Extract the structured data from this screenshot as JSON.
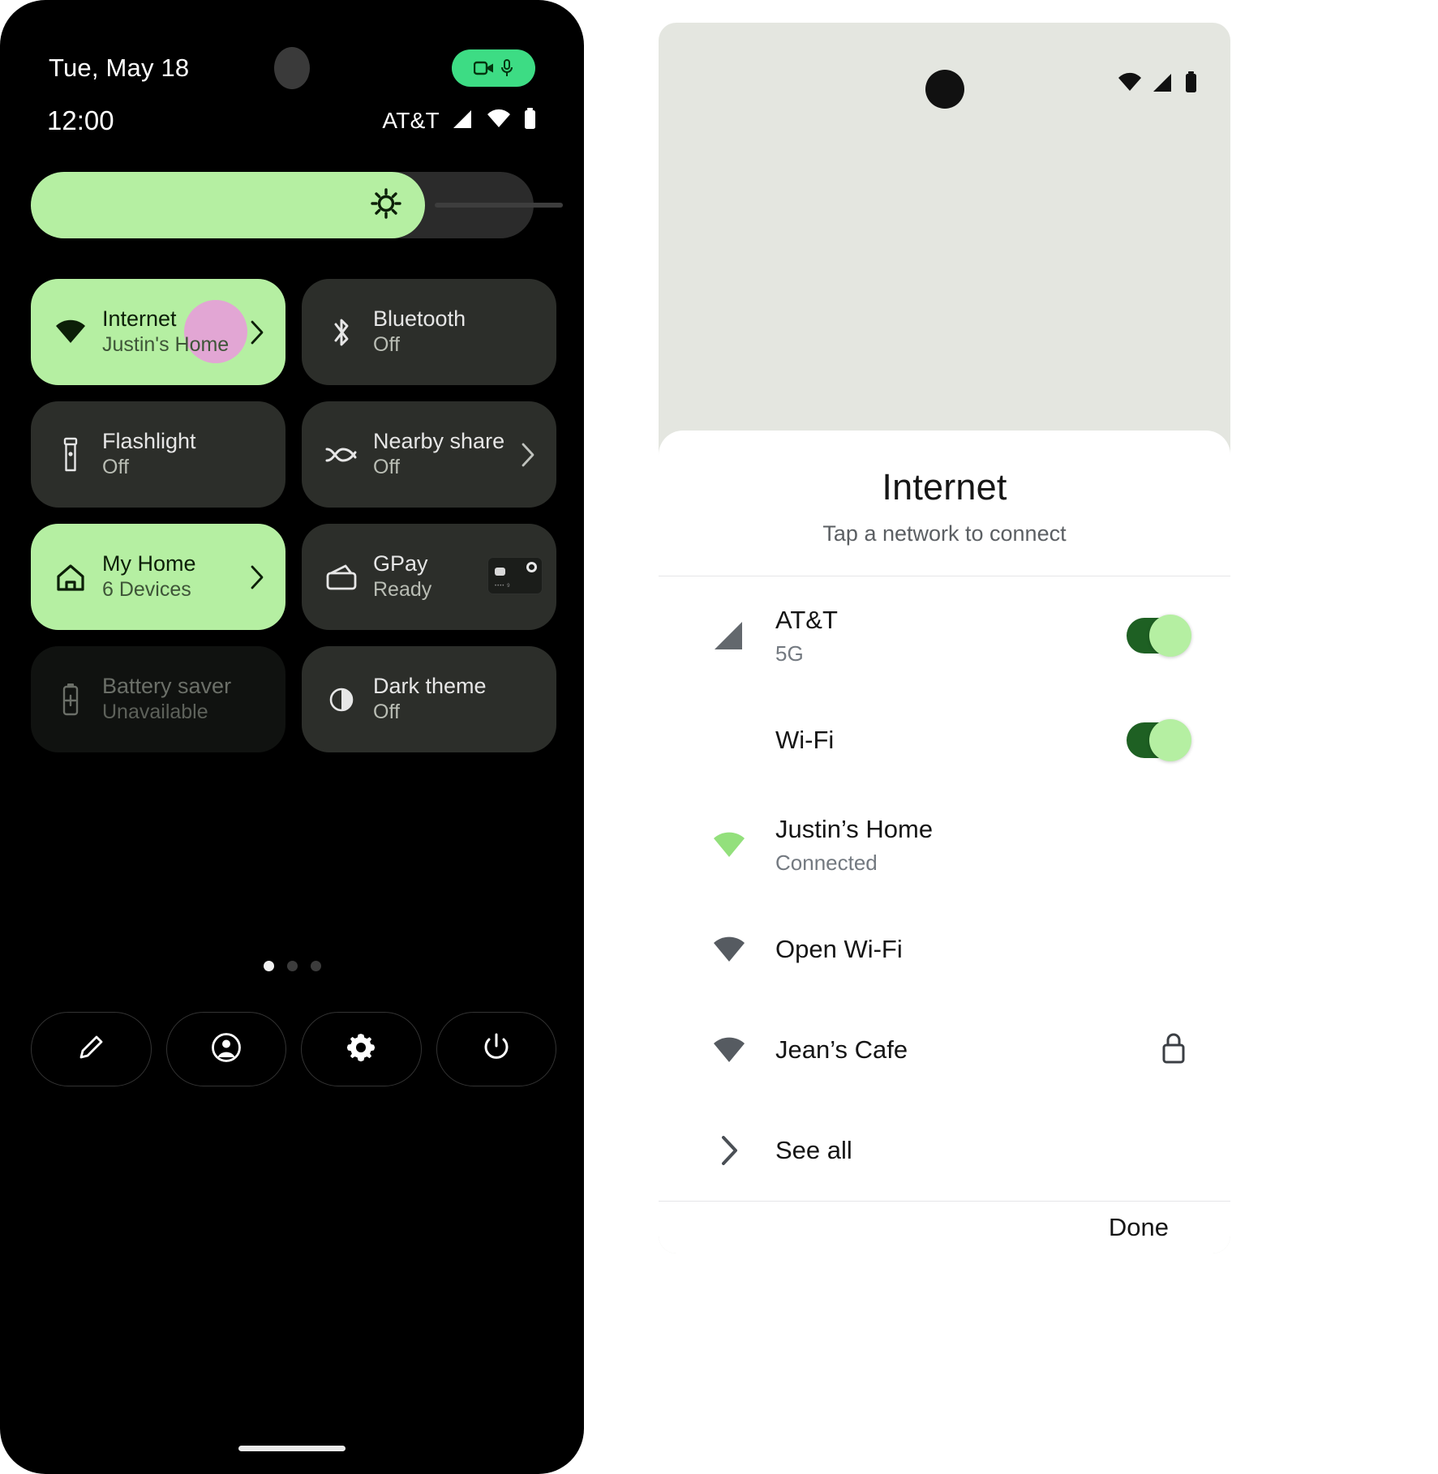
{
  "quick_settings": {
    "status_bar": {
      "date": "Tue, May 18",
      "clock": "12:00",
      "carrier": "AT&T",
      "privacy_chip": {
        "camera_icon": "video-camera-icon",
        "mic_icon": "microphone-icon"
      },
      "icons": [
        "cellular-signal-icon",
        "wifi-icon",
        "battery-icon"
      ]
    },
    "brightness": {
      "name": "brightness-slider",
      "icon": "brightness-icon",
      "fill_percent": 75
    },
    "tiles": [
      {
        "title": "Internet",
        "subtitle": "Justin's Home",
        "icon": "wifi-icon",
        "state": "active",
        "has_chevron": true,
        "touch_indicator": true
      },
      {
        "title": "Bluetooth",
        "subtitle": "Off",
        "icon": "bluetooth-icon",
        "state": "inactive",
        "has_chevron": false,
        "touch_indicator": false
      },
      {
        "title": "Flashlight",
        "subtitle": "Off",
        "icon": "flashlight-icon",
        "state": "inactive",
        "has_chevron": false,
        "touch_indicator": false
      },
      {
        "title": "Nearby share",
        "subtitle": "Off",
        "icon": "nearby-share-icon",
        "state": "inactive",
        "has_chevron": true,
        "touch_indicator": false
      },
      {
        "title": "My Home",
        "subtitle": "6 Devices",
        "icon": "home-icon",
        "state": "active",
        "has_chevron": true,
        "touch_indicator": false
      },
      {
        "title": "GPay",
        "subtitle": "Ready",
        "icon": "wallet-icon",
        "state": "inactive",
        "has_chevron": false,
        "touch_indicator": false,
        "card_thumbnail": {
          "name": "payment-card-thumbnail",
          "masked_number": "•••• 9"
        }
      },
      {
        "title": "Battery saver",
        "subtitle": "Unavailable",
        "icon": "battery-saver-icon",
        "state": "disabled",
        "has_chevron": false,
        "touch_indicator": false
      },
      {
        "title": "Dark theme",
        "subtitle": "Off",
        "icon": "dark-theme-icon",
        "state": "inactive",
        "has_chevron": false,
        "touch_indicator": false
      }
    ],
    "pagination": {
      "total": 3,
      "current": 1
    },
    "footer_buttons": [
      {
        "name": "edit-tiles-button",
        "icon": "pencil-icon"
      },
      {
        "name": "user-switcher-button",
        "icon": "account-circle-icon"
      },
      {
        "name": "settings-button",
        "icon": "gear-icon"
      },
      {
        "name": "power-button",
        "icon": "power-icon"
      }
    ]
  },
  "internet_dialog": {
    "status_bar": {
      "icons": [
        "wifi-icon",
        "cellular-signal-icon",
        "battery-icon"
      ]
    },
    "title": "Internet",
    "subtitle": "Tap a network to connect",
    "rows": [
      {
        "title": "AT&T",
        "subtitle": "5G",
        "icon": "cellular-signal-icon",
        "trailing": "toggle",
        "toggle_on": true
      },
      {
        "title": "Wi-Fi",
        "subtitle": "",
        "icon": "",
        "trailing": "toggle",
        "toggle_on": true
      },
      {
        "title": "Justin’s Home",
        "subtitle": "Connected",
        "icon": "wifi-icon-connected",
        "trailing": "none",
        "toggle_on": false
      },
      {
        "title": "Open Wi-Fi",
        "subtitle": "",
        "icon": "wifi-icon",
        "trailing": "none",
        "toggle_on": false
      },
      {
        "title": "Jean’s Cafe",
        "subtitle": "",
        "icon": "wifi-icon",
        "trailing": "lock",
        "toggle_on": false
      },
      {
        "title": "See all",
        "subtitle": "",
        "icon": "chevron-right-icon",
        "trailing": "none",
        "toggle_on": false
      }
    ],
    "done_label": "Done"
  },
  "colors": {
    "accent_green": "#b5efa2",
    "chip_green": "#3ddc84",
    "toggle_track": "#1e6023",
    "tile_bg": "#2c2e2a",
    "touch_indicator": "#e2a6d4"
  }
}
